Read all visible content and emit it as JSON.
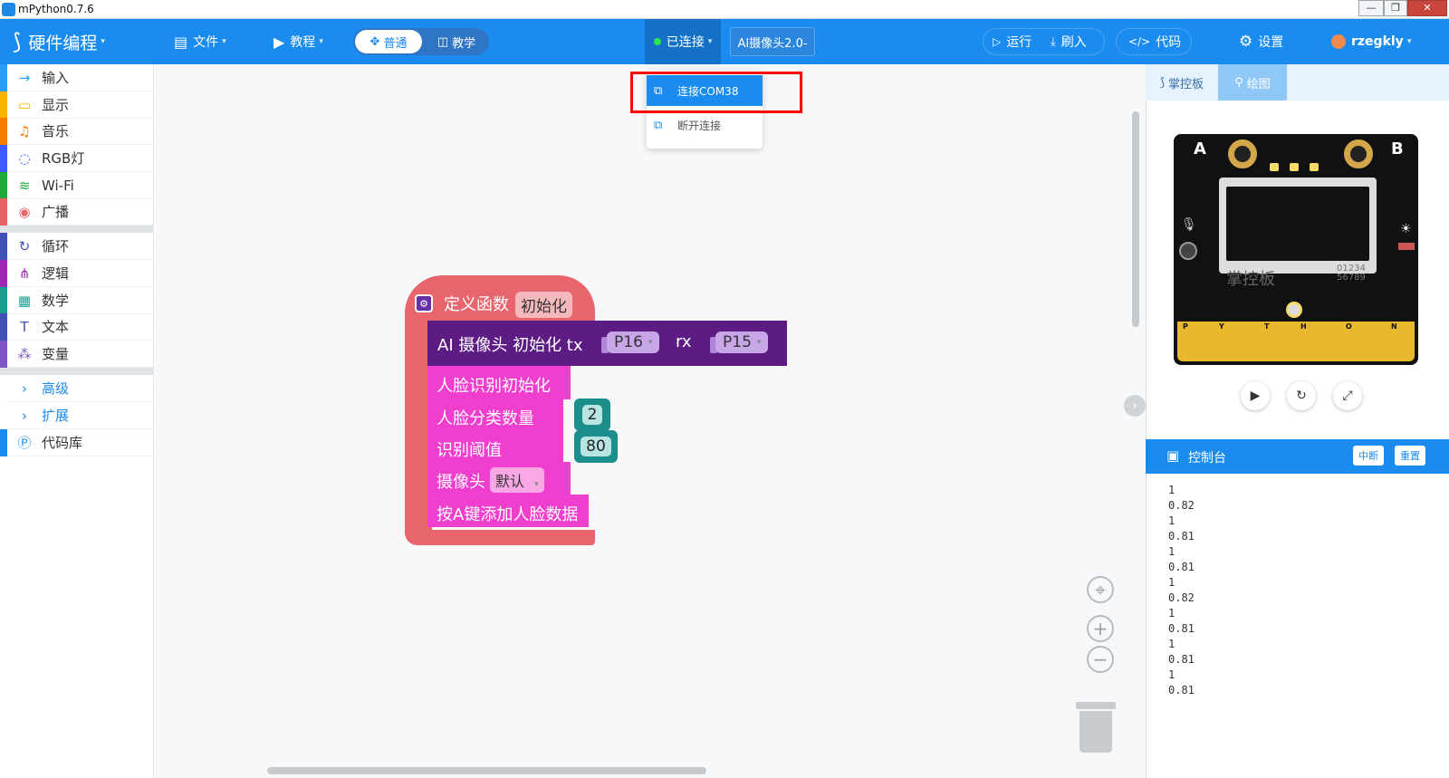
{
  "window": {
    "title": "mPython0.7.6",
    "min": "—",
    "restore": "❐",
    "close": "✕"
  },
  "toolbar": {
    "brand": "硬件编程",
    "file": "文件",
    "tutorial": "教程",
    "mode_normal": "普通",
    "mode_edu": "教学",
    "connection_status": "已连接",
    "device": "AI摄像头2.0-",
    "run": "运行",
    "flash": "刷入",
    "code": "代码",
    "settings": "设置",
    "user": "rzegkly"
  },
  "connect_menu": {
    "connect": "连接COM38",
    "disconnect": "断开连接"
  },
  "sidebar": {
    "items": [
      {
        "label": "输入",
        "color": "#2a9cf4",
        "icon": "→"
      },
      {
        "label": "显示",
        "color": "#f7b500",
        "icon": "▭"
      },
      {
        "label": "音乐",
        "color": "#f57c00",
        "icon": "♫"
      },
      {
        "label": "RGB灯",
        "color": "#3d5afe",
        "icon": "◌"
      },
      {
        "label": "Wi-Fi",
        "color": "#1fa83a",
        "icon": "≋"
      },
      {
        "label": "广播",
        "color": "#e86565",
        "icon": "◉"
      },
      {
        "label": "循环",
        "color": "#3f51b5",
        "icon": "↻"
      },
      {
        "label": "逻辑",
        "color": "#9c27b0",
        "icon": "⋔"
      },
      {
        "label": "数学",
        "color": "#1a9f8f",
        "icon": "▦"
      },
      {
        "label": "文本",
        "color": "#3f51b5",
        "icon": "T"
      },
      {
        "label": "变量",
        "color": "#7e57c2",
        "icon": "⁂"
      },
      {
        "label": "高级",
        "color": "#ffffff",
        "icon": "›"
      },
      {
        "label": "扩展",
        "color": "#ffffff",
        "icon": "›"
      },
      {
        "label": "代码库",
        "color": "#1a8cf0",
        "icon": "Ⓟ"
      }
    ]
  },
  "blocks": {
    "func_def": "定义函数",
    "func_name": "初始化",
    "ai_init": "AI 摄像头 初始化 tx",
    "tx_pin": "P16",
    "rx_label": "rx",
    "rx_pin": "P15",
    "face_init": "人脸识别初始化",
    "face_count_label": "人脸分类数量",
    "face_count": "2",
    "threshold_label": "识别阈值",
    "threshold": "80",
    "camera_label": "摄像头",
    "camera_value": "默认",
    "add_face": "按A键添加人脸数据"
  },
  "right_panel": {
    "tab_board": "掌控板",
    "tab_draw": "绘图",
    "board_letter_a": "A",
    "board_letter_b": "B",
    "board_brand": "掌控板",
    "board_code": "01234 56789",
    "pins": [
      "P",
      "Y",
      "T",
      "H",
      "O",
      "N"
    ],
    "console_title": "控制台",
    "btn_interrupt": "中断",
    "btn_reset": "重置",
    "console_lines": [
      "1",
      "0.82",
      "1",
      "0.81",
      "1",
      "0.81",
      "1",
      "0.82",
      "1",
      "0.81",
      "1",
      "0.81",
      "1",
      "0.81"
    ]
  }
}
